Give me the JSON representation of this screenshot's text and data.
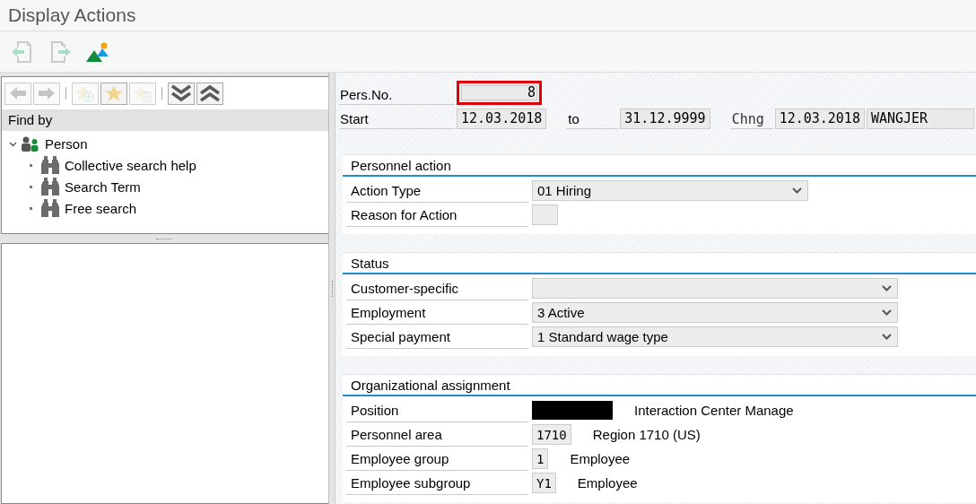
{
  "window": {
    "title": "Display Actions"
  },
  "toolbar": [
    {
      "kind": "previous-page",
      "disabled": true
    },
    {
      "kind": "next-page",
      "disabled": true
    },
    {
      "kind": "landscape",
      "disabled": false
    }
  ],
  "nav_toolbar": [
    {
      "kind": "back",
      "disabled": true
    },
    {
      "kind": "forward",
      "disabled": true
    },
    {
      "kind": "separator"
    },
    {
      "kind": "add-favorite",
      "disabled": true
    },
    {
      "kind": "favorite",
      "disabled": false
    },
    {
      "kind": "delete-favorite",
      "disabled": true
    },
    {
      "kind": "separator"
    },
    {
      "kind": "expand-all",
      "disabled": false
    },
    {
      "kind": "collapse-all",
      "disabled": false
    }
  ],
  "find_by": {
    "header": "Find by",
    "tree": [
      {
        "label": "Person",
        "expanded": true,
        "children": [
          {
            "label": "Collective search help"
          },
          {
            "label": "Search Term"
          },
          {
            "label": "Free search"
          }
        ]
      }
    ]
  },
  "header": {
    "pers_no": {
      "label": "Pers.No.",
      "value": "8",
      "highlighted": true
    },
    "start": {
      "label": "Start",
      "value": "12.03.2018"
    },
    "to": {
      "label": "to",
      "value": "31.12.9999"
    },
    "changed": {
      "label": "Chng",
      "date": "12.03.2018",
      "user": "WANGJER"
    }
  },
  "sections": [
    {
      "title": "Personnel action",
      "rows": [
        {
          "label": "Action Type",
          "kind": "dropdown",
          "value": "01 Hiring"
        },
        {
          "label": "Reason for Action",
          "kind": "field",
          "value": ""
        }
      ]
    },
    {
      "title": "Status",
      "rows": [
        {
          "label": "Customer-specific",
          "kind": "dropdown",
          "value": ""
        },
        {
          "label": "Employment",
          "kind": "dropdown",
          "value": "3 Active"
        },
        {
          "label": "Special payment",
          "kind": "dropdown",
          "value": "1 Standard wage type"
        }
      ]
    },
    {
      "title": "Organizational assignment",
      "rows": [
        {
          "label": "Position",
          "kind": "redacted",
          "value": "",
          "text": "Interaction Center Manage"
        },
        {
          "label": "Personnel area",
          "kind": "field",
          "value": "1710",
          "text": "Region 1710 (US)"
        },
        {
          "label": "Employee group",
          "kind": "field",
          "value": "1",
          "text": "Employee"
        },
        {
          "label": "Employee subgroup",
          "kind": "field",
          "value": "Y1",
          "text": "Employee"
        }
      ]
    }
  ]
}
